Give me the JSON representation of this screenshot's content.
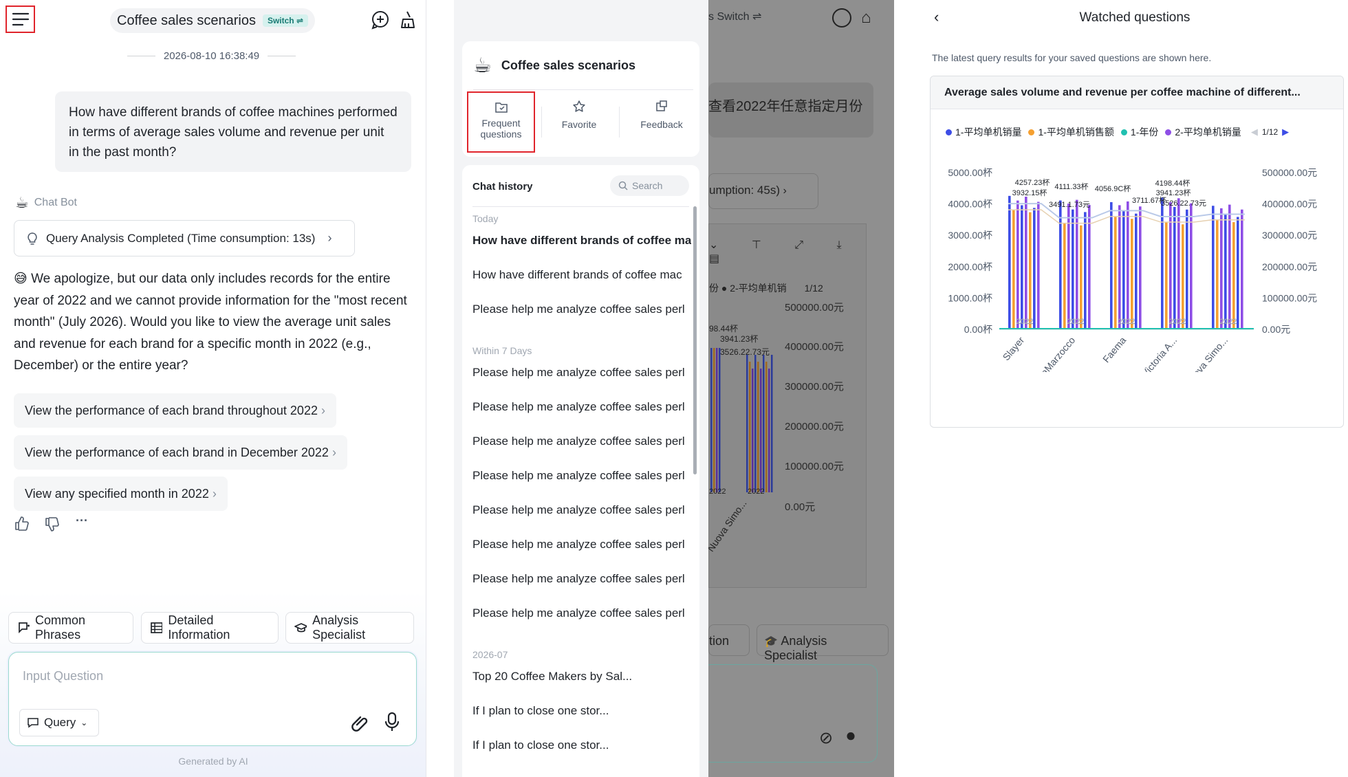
{
  "p1": {
    "header_title": "Coffee sales scenarios",
    "switch_label": "Switch ⇌",
    "timestamp": "2026-08-10 16:38:49",
    "user_question": "How have different brands of coffee machines performed in terms of average sales volume and revenue per unit in the past month?",
    "bot_name": "Chat Bot",
    "analysis_label": "Query Analysis Completed (Time consumption: 13s)",
    "answer": "😅 We apologize, but our data only includes records for the entire year of 2022 and we cannot provide information for the \"most recent month\" (July 2026). Would you like to view the average unit sales and revenue for each brand for a specific month in 2022 (e.g., December) or the entire year?",
    "suggestions": [
      "View the performance of each brand throughout 2022",
      "View the performance of each brand in December 2022",
      "View any specified month in 2022"
    ],
    "more_label": "···",
    "chips": [
      "Common Phrases",
      "Detailed Information",
      "Analysis Specialist"
    ],
    "input_placeholder": "Input Question",
    "mode_label": "Query",
    "footer": "Generated by AI"
  },
  "p2": {
    "scenario_title": "Coffee sales scenarios",
    "actions": [
      "Frequent questions",
      "Favorite",
      "Feedback"
    ],
    "history_title": "Chat history",
    "search_placeholder": "Search",
    "groups": [
      {
        "label": "Today",
        "items": [
          "How have different brands of coffee ma",
          "How have different brands of coffee mac",
          "Please help me analyze coffee sales perl"
        ]
      },
      {
        "label": "Within 7 Days",
        "items": [
          "Please help me analyze coffee sales perl",
          "Please help me analyze coffee sales perl",
          "Please help me analyze coffee sales perl",
          "Please help me analyze coffee sales perl",
          "Please help me analyze coffee sales perl",
          "Please help me analyze coffee sales perl",
          "Please help me analyze coffee sales perl",
          "Please help me analyze coffee sales perl"
        ]
      },
      {
        "label": "2026-07",
        "items": [
          "Top 20 Coffee Makers by Sal...",
          "If I plan to close one stor...",
          "If I plan to close one stor..."
        ]
      }
    ],
    "bg_switch": "s Switch ⇌",
    "bg_question": "查看2022年任意指定月份",
    "bg_consumption": "umption: 45s)",
    "bg_legend": "份  ● 2-平均单机销",
    "bg_page": "1/12",
    "bg_ylabels": [
      "500000.00元",
      "400000.00元",
      "300000.00元",
      "200000.00元",
      "100000.00元",
      "0.00元"
    ],
    "bg_annots": [
      "98.44杯",
      "3941.23杯",
      "3526.22.73元"
    ],
    "bg_chip_a": "tion",
    "bg_chip_b": "Analysis Specialist",
    "bg_xlabel": "Nuova Simo...",
    "bg_bar_label": "2022"
  },
  "p3": {
    "title": "Watched questions",
    "subtitle": "The latest query results for your saved questions are shown here.",
    "card_title": "Average sales volume and revenue per coffee machine of different...",
    "page": "1/12"
  },
  "colors": {
    "accent": "#20b2aa",
    "blue": "#3d4de6",
    "orange": "#f5a031",
    "teal": "#20c0b0",
    "purple": "#8e4ee6",
    "highlight": "#e0242b"
  },
  "chart_data": {
    "type": "bar",
    "title": "Average sales volume and revenue per coffee machine of different...",
    "categories": [
      "Slayer",
      "LaMarzocco",
      "Faema",
      "Victoria A...",
      "Nuova Simo..."
    ],
    "series": [
      {
        "name": "1-平均单机销量",
        "values": [
          4257.23,
          4111.33,
          4056.9,
          4198.44,
          3941.23
        ]
      },
      {
        "name": "1-平均单机销售额",
        "values": [
          393215,
          349111.73,
          371167,
          352622.73,
          360000
        ]
      },
      {
        "name": "1-年份",
        "values": [
          2022,
          2022,
          2022,
          2022,
          2022
        ]
      },
      {
        "name": "2-平均单机销量",
        "values": [
          4150,
          4050,
          4000,
          4100,
          3900
        ]
      }
    ],
    "bar_label": "2022",
    "annotations": [
      "4257.23杯",
      "3932.15杯",
      "4111.33杯",
      "3491.1.73元",
      "4056.9C杯",
      "3711.67杯",
      "4198.44杯",
      "3941.23杯",
      "3526.22.73元"
    ],
    "y_left": {
      "ticks": [
        "0.00杯",
        "1000.00杯",
        "2000.00杯",
        "3000.00杯",
        "4000.00杯",
        "5000.00杯"
      ],
      "range": [
        0,
        5000
      ]
    },
    "y_right": {
      "ticks": [
        "0.00元",
        "100000.00元",
        "200000.00元",
        "300000.00元",
        "400000.00元",
        "500000.00元"
      ],
      "range": [
        0,
        500000
      ]
    },
    "legend_position": "top"
  }
}
